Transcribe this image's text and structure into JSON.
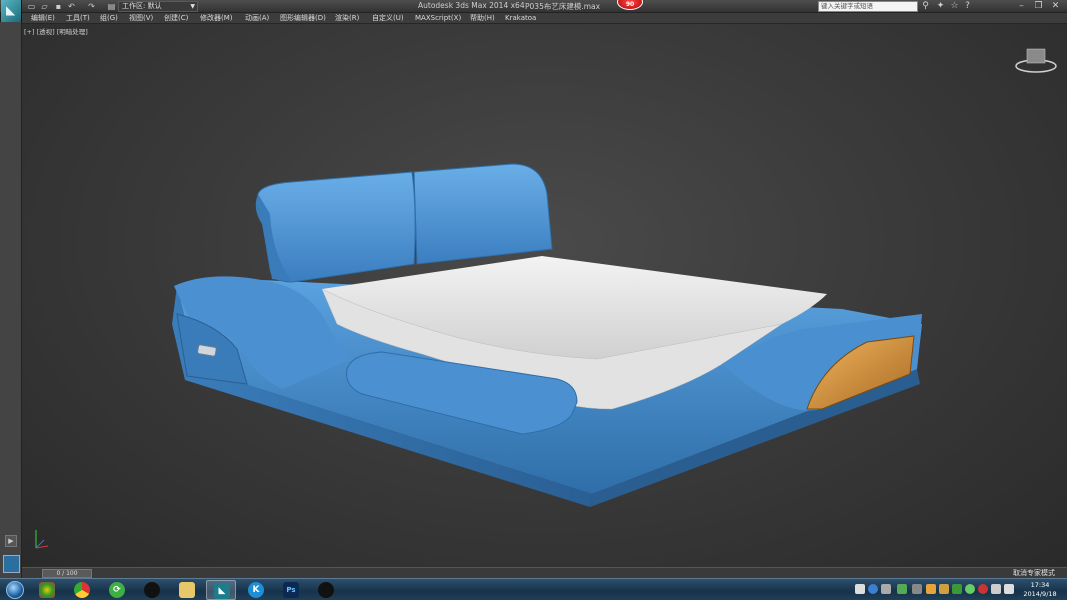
{
  "titlebar": {
    "workspace": "工作区: 默认",
    "app_title": "Autodesk 3ds Max  2014 x64",
    "file_name": "P035布艺床建模.max",
    "notification_count": "90",
    "search_placeholder": "键入关键字或短语"
  },
  "menu": [
    {
      "label": "编辑(E)"
    },
    {
      "label": "工具(T)"
    },
    {
      "label": "组(G)"
    },
    {
      "label": "视图(V)"
    },
    {
      "label": "创建(C)"
    },
    {
      "label": "修改器(M)"
    },
    {
      "label": "动画(A)"
    },
    {
      "label": "图形编辑器(D)"
    },
    {
      "label": "渲染(R)"
    },
    {
      "label": "自定义(U)"
    },
    {
      "label": "MAXScript(X)"
    },
    {
      "label": "帮助(H)"
    },
    {
      "label": "Krakatoa"
    }
  ],
  "viewport": {
    "label": "[+] [透视] [明暗处理]",
    "background_color": "#3b3b3b",
    "model_primary_color": "#4a8fd0",
    "mattress_color": "#ececec",
    "shelf_color": "#d99a45"
  },
  "timeline": {
    "frame": "0 / 100",
    "expert_mode": "取消专家模式"
  },
  "taskbar": {
    "apps": [
      {
        "icon": "color-balls-app-icon",
        "letter": ""
      },
      {
        "icon": "chrome-icon",
        "letter": ""
      },
      {
        "icon": "refresh-app-icon",
        "letter": ""
      },
      {
        "icon": "qq-penguin-icon",
        "letter": ""
      },
      {
        "icon": "folder-icon",
        "letter": ""
      },
      {
        "icon": "3dsmax-icon",
        "letter": ""
      },
      {
        "icon": "k-app-icon",
        "letter": "K"
      },
      {
        "icon": "photoshop-icon",
        "letter": "Ps"
      },
      {
        "icon": "qq-penguin-icon",
        "letter": ""
      }
    ],
    "time": "17:34",
    "date": "2014/9/18"
  }
}
